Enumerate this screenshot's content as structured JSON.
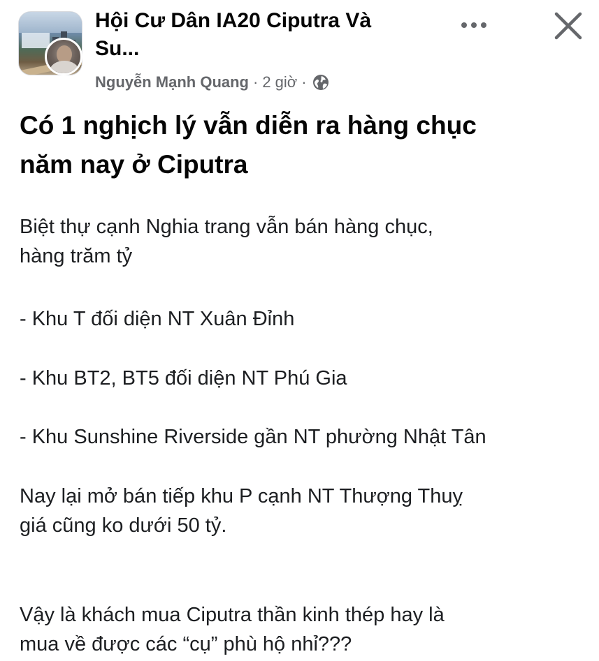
{
  "post": {
    "group_name_line1": "Hội Cư Dân IA20 Ciputra Và",
    "group_name_line2": "Su",
    "group_name_ellipsis": "...",
    "author": "Nguyễn Mạnh Quang",
    "separator": "·",
    "time": "2 giờ",
    "privacy_icon": "globe-icon",
    "more_icon": "more-dots-icon",
    "close_icon": "close-icon",
    "title_line1": "Có 1 nghịch lý vẫn diễn ra hàng chục",
    "title_line2": "năm nay ở Ciputra",
    "body": {
      "p1_line1": "Biệt thự cạnh Nghia trang vẫn bán hàng chục,",
      "p1_line2": "hàng trăm tỷ",
      "p2": "- Khu T đối diện NT Xuân Đỉnh",
      "p3": "- Khu BT2, BT5 đối diện NT Phú Gia",
      "p4": "- Khu Sunshine Riverside gần NT phường Nhật Tân",
      "p5_line1": "Nay lại mở bán tiếp khu P cạnh NT Thượng Thuỵ",
      "p5_line2": "giá cũng ko dưới 50 tỷ.",
      "p6_line1": "Vậy là khách mua Ciputra thần kinh thép hay là",
      "p6_line2": "mua về được các “cụ” phù hộ nhỉ???"
    }
  },
  "colors": {
    "text_primary": "#050505",
    "text_secondary": "#65676b",
    "background": "#ffffff"
  }
}
